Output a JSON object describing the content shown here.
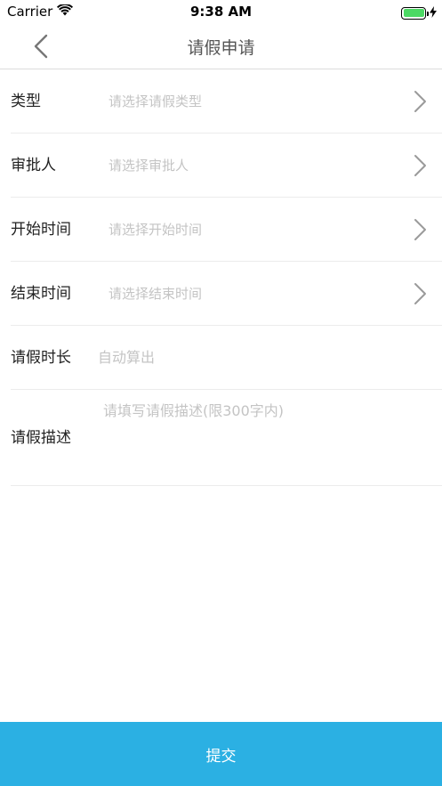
{
  "status_bar": {
    "carrier": "Carrier",
    "time": "9:38 AM"
  },
  "nav": {
    "title": "请假申请"
  },
  "form": {
    "rows": [
      {
        "label": "类型",
        "placeholder": "请选择请假类型"
      },
      {
        "label": "审批人",
        "placeholder": "请选择审批人"
      },
      {
        "label": "开始时间",
        "placeholder": "请选择开始时间"
      },
      {
        "label": "结束时间",
        "placeholder": "请选择结束时间"
      },
      {
        "label": "请假时长",
        "placeholder": "自动算出"
      }
    ],
    "description": {
      "label": "请假描述",
      "placeholder": "请填写请假描述(限300字内)"
    }
  },
  "submit": {
    "label": "提交"
  },
  "colors": {
    "accent": "#2bb0e3",
    "battery": "#4cd964",
    "placeholder": "#c4c4c4"
  },
  "icons": [
    "wifi-icon",
    "battery-icon",
    "charging-bolt-icon",
    "back-chevron-icon",
    "chevron-right-icon"
  ]
}
